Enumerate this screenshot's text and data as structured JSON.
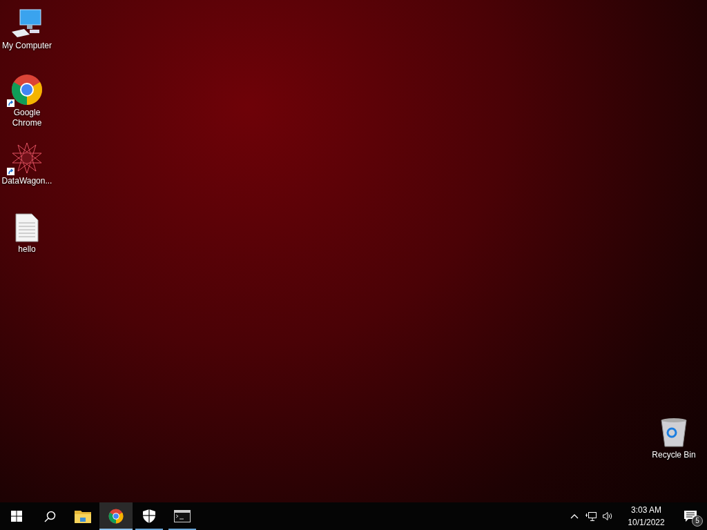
{
  "desktop_icons": [
    {
      "label": "My Computer",
      "kind": "computer",
      "shortcut": false
    },
    {
      "label": "Google Chrome",
      "kind": "chrome",
      "shortcut": true
    },
    {
      "label": "DataWagon...",
      "kind": "star",
      "shortcut": true
    },
    {
      "label": "hello",
      "kind": "document",
      "shortcut": false
    },
    {
      "label": "Recycle Bin",
      "kind": "recycle",
      "shortcut": false
    }
  ],
  "taskbar": {
    "apps": [
      {
        "kind": "folder",
        "running": false,
        "active": false
      },
      {
        "kind": "chrome",
        "running": true,
        "active": true
      },
      {
        "kind": "shield",
        "running": true,
        "active": false
      },
      {
        "kind": "terminal",
        "running": true,
        "active": false
      }
    ],
    "clock": {
      "time": "3:03 AM",
      "date": "10/1/2022"
    },
    "notification_count": "5"
  }
}
